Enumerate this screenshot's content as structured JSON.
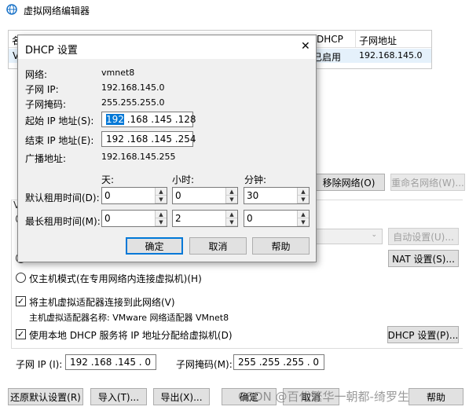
{
  "main_window": {
    "title": "虚拟网络编辑器",
    "table": {
      "headers_visible": [
        "名",
        "DHCP",
        "子网地址"
      ],
      "row": {
        "name_partial": "V",
        "dhcp": "已启用",
        "subnet": "192.168.145.0"
      }
    },
    "buttons": {
      "remove_network": "移除网络(O)",
      "rename_network": "重命名网络(W)...",
      "auto_settings": "自动设置(U)...",
      "nat_settings": "NAT 设置(S)...",
      "dhcp_settings": "DHCP 设置(P)...",
      "restore_defaults": "还原默认设置(R)",
      "import": "导入(T)...",
      "export": "导出(X)...",
      "ok": "确定",
      "cancel": "取消",
      "help": "帮助"
    },
    "hostonly_radio": "仅主机模式(在专用网络内连接虚拟机)(H)",
    "connect_adapter_checkbox": "将主机虚拟适配器连接到此网络(V)",
    "adapter_name_label": "主机虚拟适配器名称: VMware 网络适配器 VMnet8",
    "use_dhcp_checkbox": "使用本地 DHCP 服务将 IP 地址分配给虚拟机(D)",
    "subnet_ip_label": "子网 IP (I):",
    "subnet_ip_value": "192 .168 .145 . 0",
    "subnet_mask_label": "子网掩码(M):",
    "subnet_mask_value": "255 .255 .255 . 0",
    "watermark": "CSDN @百代繁华一朝都-绮罗生"
  },
  "dhcp_dialog": {
    "title": "DHCP 设置",
    "close_glyph": "✕",
    "network_label": "网络:",
    "network_value": "vmnet8",
    "subnet_ip_label": "子网 IP:",
    "subnet_ip_value": "192.168.145.0",
    "subnet_mask_label": "子网掩码:",
    "subnet_mask_value": "255.255.255.0",
    "start_ip_label": "起始 IP 地址(S):",
    "start_ip_first": "192",
    "start_ip_rest": " .168 .145 .128",
    "end_ip_label": "结束 IP 地址(E):",
    "end_ip_value": "192 .168 .145 .254",
    "broadcast_label": "广播地址:",
    "broadcast_value": "192.168.145.255",
    "days_label": "天:",
    "hours_label": "小时:",
    "minutes_label": "分钟:",
    "default_lease_label": "默认租用时间(D):",
    "default_lease": {
      "days": "0",
      "hours": "0",
      "minutes": "30"
    },
    "max_lease_label": "最长租用时间(M):",
    "max_lease": {
      "days": "0",
      "hours": "2",
      "minutes": "0"
    },
    "ok": "确定",
    "cancel": "取消",
    "help": "帮助",
    "spin_up": "▲",
    "spin_down": "▼"
  },
  "colors": {
    "selection": "#0078d7",
    "dialog_bg": "#f0f0f0",
    "accent_icon": "#1a73c8"
  }
}
